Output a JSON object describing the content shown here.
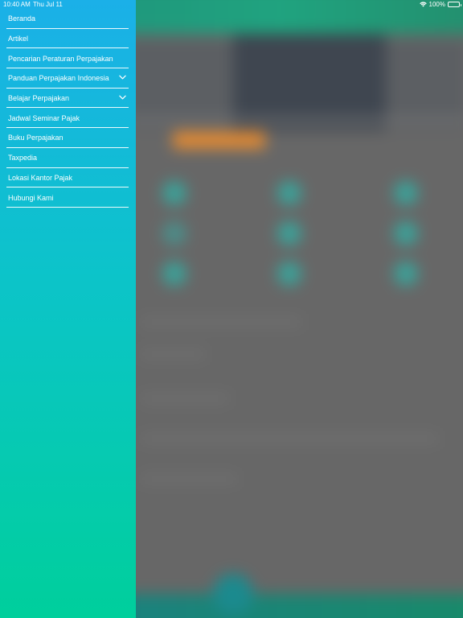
{
  "status_bar": {
    "time": "10:40 AM",
    "date": "Thu Jul 11",
    "battery": "100%",
    "icons": [
      "wifi-icon",
      "battery-icon"
    ]
  },
  "drawer": {
    "items": [
      {
        "label": "Beranda",
        "expandable": false
      },
      {
        "label": "Artikel",
        "expandable": false
      },
      {
        "label": "Pencarian Peraturan Perpajakan",
        "expandable": false
      },
      {
        "label": "Panduan Perpajakan Indonesia",
        "expandable": true,
        "icon": "chevron-down-icon"
      },
      {
        "label": "Belajar Perpajakan",
        "expandable": true,
        "icon": "chevron-down-icon"
      },
      {
        "label": "Jadwal Seminar Pajak",
        "expandable": false
      },
      {
        "label": "Buku Perpajakan",
        "expandable": false
      },
      {
        "label": "Taxpedia",
        "expandable": false
      },
      {
        "label": "Lokasi Kantor Pajak",
        "expandable": false
      },
      {
        "label": "Hubungi Kami",
        "expandable": false
      }
    ]
  },
  "colors": {
    "drawer_top": "#1bb0e8",
    "drawer_bottom": "#00cf9c",
    "divider": "#ffffff",
    "background_overlay": "#676767"
  }
}
